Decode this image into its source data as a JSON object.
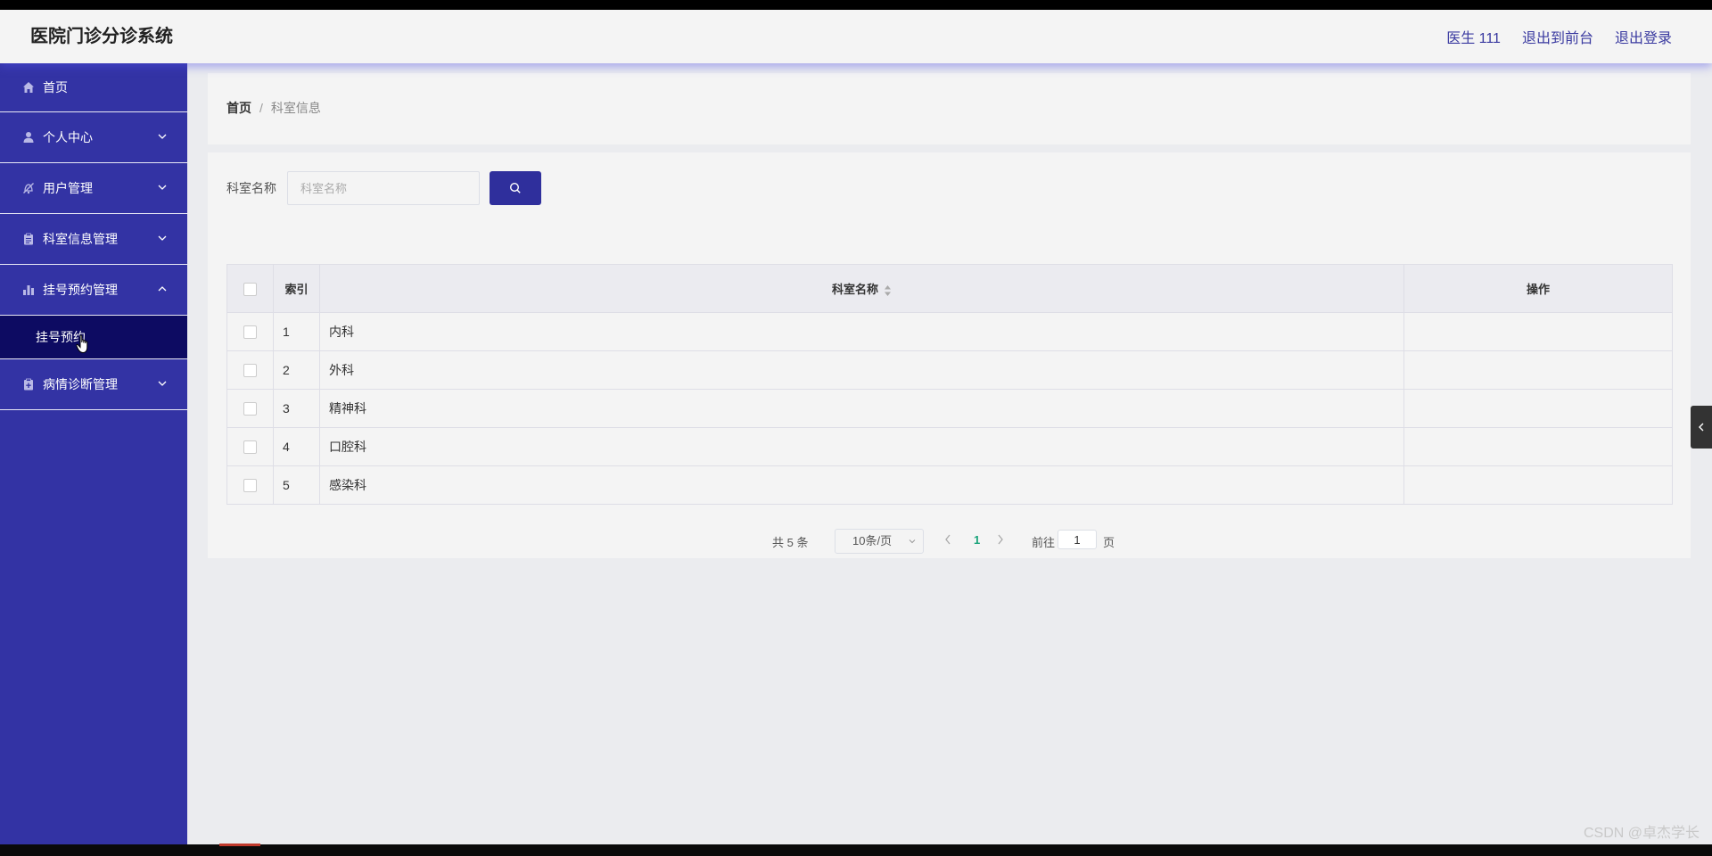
{
  "header": {
    "app_title": "医院门诊分诊系统",
    "user_label": "医生 111",
    "back_to_front": "退出到前台",
    "logout": "退出登录"
  },
  "sidebar": {
    "items": [
      {
        "label": "首页",
        "icon": "home-icon",
        "expandable": false
      },
      {
        "label": "个人中心",
        "icon": "user-icon",
        "expandable": true
      },
      {
        "label": "用户管理",
        "icon": "user-manage-icon",
        "expandable": true
      },
      {
        "label": "科室信息管理",
        "icon": "clipboard-icon",
        "expandable": true
      },
      {
        "label": "挂号预约管理",
        "icon": "bar-chart-icon",
        "expandable": true,
        "expanded": true,
        "children": [
          "挂号预约"
        ]
      },
      {
        "label": "病情诊断管理",
        "icon": "diagnosis-icon",
        "expandable": true
      }
    ]
  },
  "breadcrumb": {
    "home": "首页",
    "separator": "/",
    "current": "科室信息"
  },
  "search": {
    "label": "科室名称",
    "placeholder": "科室名称",
    "value": ""
  },
  "table": {
    "columns": {
      "index": "索引",
      "name": "科室名称",
      "actions": "操作"
    },
    "rows": [
      {
        "index": "1",
        "name": "内科"
      },
      {
        "index": "2",
        "name": "外科"
      },
      {
        "index": "3",
        "name": "精神科"
      },
      {
        "index": "4",
        "name": "口腔科"
      },
      {
        "index": "5",
        "name": "感染科"
      }
    ]
  },
  "pagination": {
    "total": "共 5 条",
    "page_size": "10条/页",
    "current_page": "1",
    "goto_label": "前往",
    "goto_value": "1",
    "page_suffix": "页"
  },
  "watermark": "CSDN @卓杰学长",
  "colors": {
    "sidebar_bg": "#3333a4",
    "submenu_active_bg": "#0d0b62",
    "accent": "#2f2f9c",
    "header_link": "#3a3aa0",
    "page_active": "#1aa37a"
  }
}
